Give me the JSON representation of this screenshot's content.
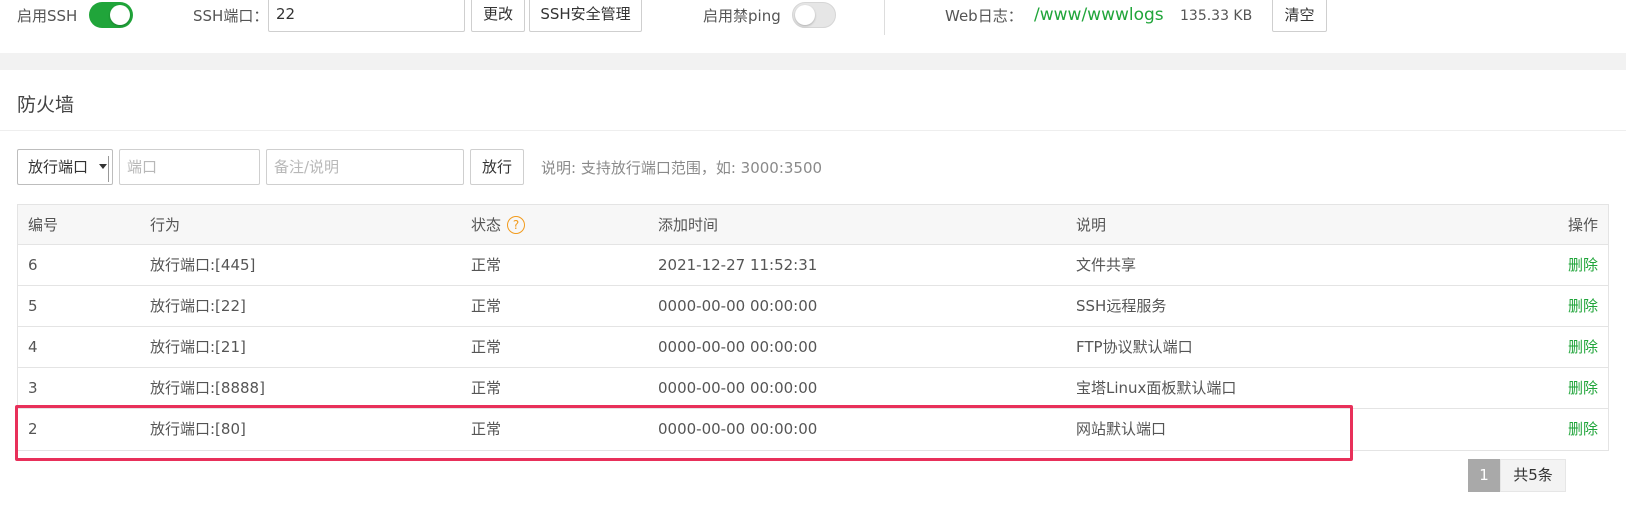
{
  "top_bar": {
    "ssh_label": "启用SSH",
    "ssh_enabled": true,
    "ssh_port_label": "SSH端口：",
    "ssh_port_value": "22",
    "change_button": "更改",
    "ssh_security_button": "SSH安全管理",
    "ping_label": "启用禁ping",
    "ping_enabled": false,
    "weblog_label": "Web日志：",
    "weblog_path": "/www/wwwlogs",
    "weblog_size": "135.33 KB",
    "clear_button": "清空"
  },
  "firewall": {
    "title": "防火墙",
    "rule_type_selected": "放行端口",
    "port_placeholder": "端口",
    "note_placeholder": "备注/说明",
    "allow_button": "放行",
    "hint": "说明: 支持放行端口范围，如: 3000:3500"
  },
  "table": {
    "headers": [
      "编号",
      "行为",
      "状态",
      "添加时间",
      "说明",
      "操作"
    ],
    "status_help_icon": "?",
    "rows": [
      {
        "id": "6",
        "action": "放行端口:[445]",
        "status": "正常",
        "time": "2021-12-27 11:52:31",
        "note": "文件共享",
        "op": "删除"
      },
      {
        "id": "5",
        "action": "放行端口:[22]",
        "status": "正常",
        "time": "0000-00-00 00:00:00",
        "note": "SSH远程服务",
        "op": "删除"
      },
      {
        "id": "4",
        "action": "放行端口:[21]",
        "status": "正常",
        "time": "0000-00-00 00:00:00",
        "note": "FTP协议默认端口",
        "op": "删除"
      },
      {
        "id": "3",
        "action": "放行端口:[8888]",
        "status": "正常",
        "time": "0000-00-00 00:00:00",
        "note": "宝塔Linux面板默认端口",
        "op": "删除"
      },
      {
        "id": "2",
        "action": "放行端口:[80]",
        "status": "正常",
        "time": "0000-00-00 00:00:00",
        "note": "网站默认端口",
        "op": "删除"
      }
    ]
  },
  "pagination": {
    "current_page": "1",
    "total": "共5条"
  },
  "colors": {
    "accent_green": "#20a53a",
    "highlight_red": "#e8305a",
    "help_orange": "#f29b1d"
  }
}
